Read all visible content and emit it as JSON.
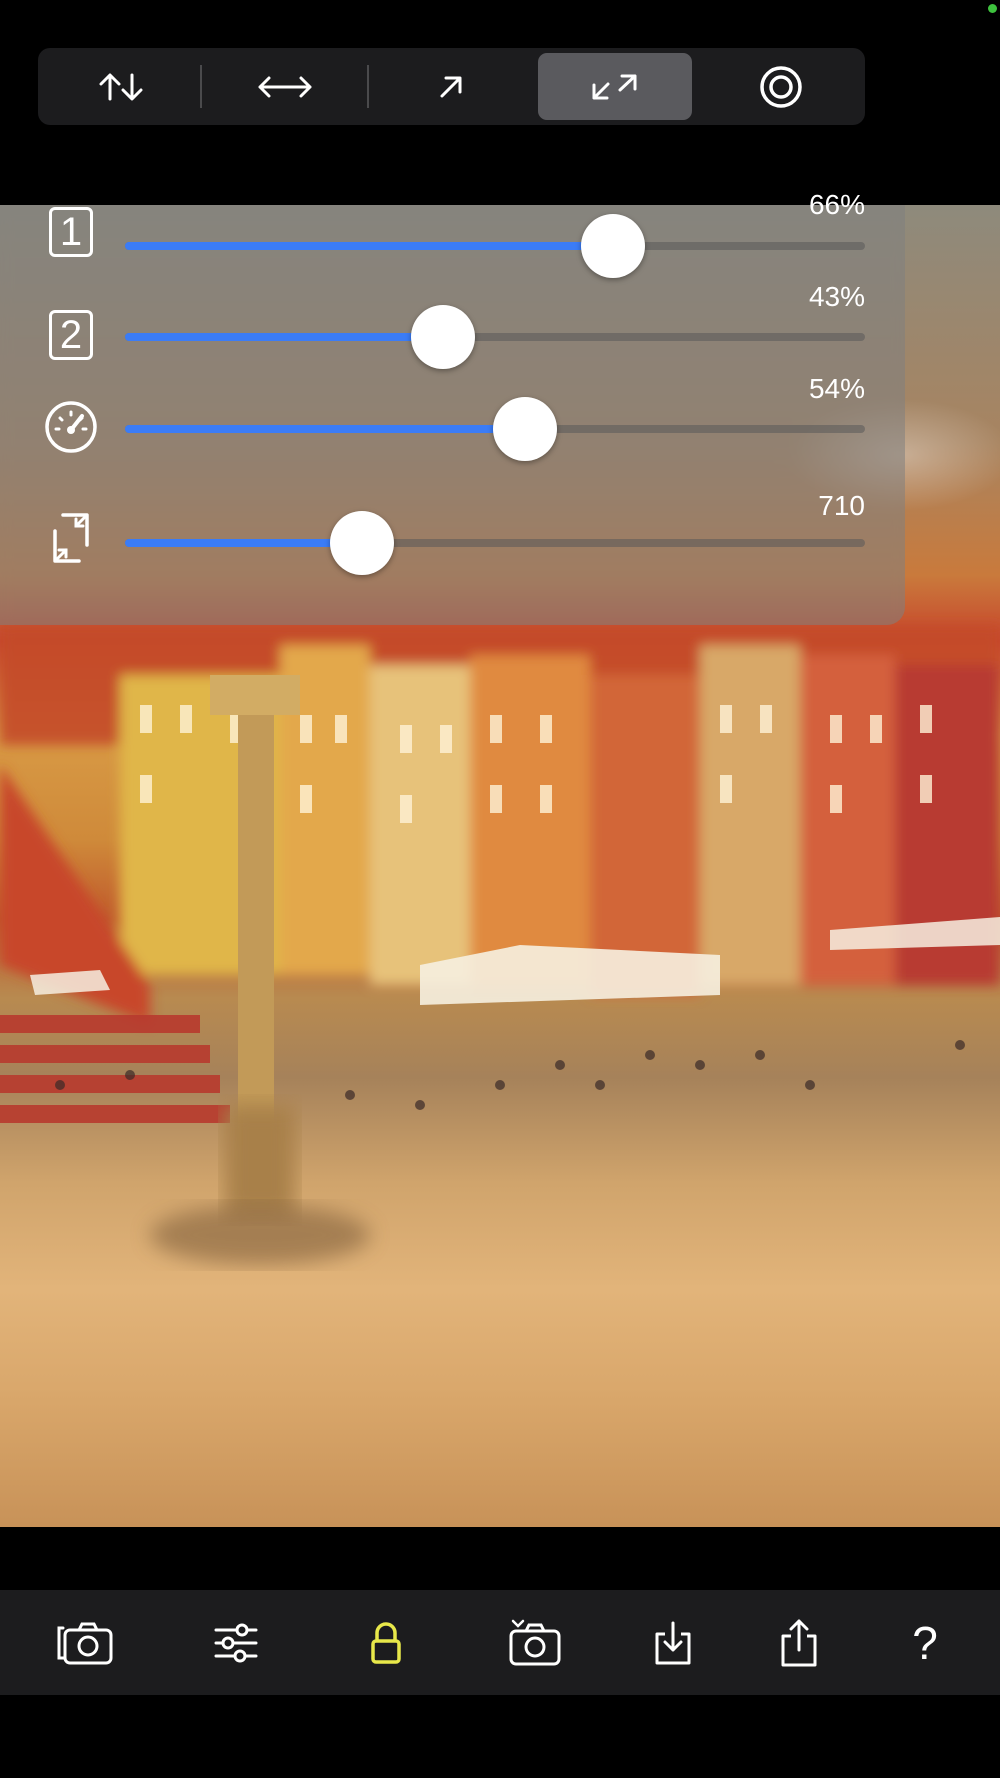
{
  "mode_bar": {
    "buttons": [
      {
        "icon": "vertical-arrows-icon",
        "selected": false
      },
      {
        "icon": "horizontal-arrows-icon",
        "selected": false
      },
      {
        "icon": "diagonal-arrow-icon",
        "selected": false
      },
      {
        "icon": "expand-diagonal-arrows-icon",
        "selected": true
      },
      {
        "icon": "radial-target-icon",
        "selected": false
      }
    ]
  },
  "sliders": [
    {
      "icon_label": "1",
      "icon": "number-1-icon",
      "value_text": "66%",
      "value": 0.66
    },
    {
      "icon_label": "2",
      "icon": "number-2-icon",
      "value_text": "43%",
      "value": 0.43
    },
    {
      "icon": "speedometer-icon",
      "value_text": "54%",
      "value": 0.54
    },
    {
      "icon": "resize-frame-icon",
      "value_text": "710",
      "value": 0.32
    }
  ],
  "bottom_bar": {
    "buttons": [
      {
        "icon": "switch-camera-icon"
      },
      {
        "icon": "sliders-icon"
      },
      {
        "icon": "lock-icon",
        "active": true
      },
      {
        "icon": "camera-capture-icon"
      },
      {
        "icon": "save-download-icon"
      },
      {
        "icon": "share-icon"
      },
      {
        "icon": "help-icon",
        "label": "?"
      }
    ]
  },
  "colors": {
    "accent_slider": "#3b7cf6",
    "lock_active": "#e8e84a",
    "status_dot": "#3ec23e"
  }
}
